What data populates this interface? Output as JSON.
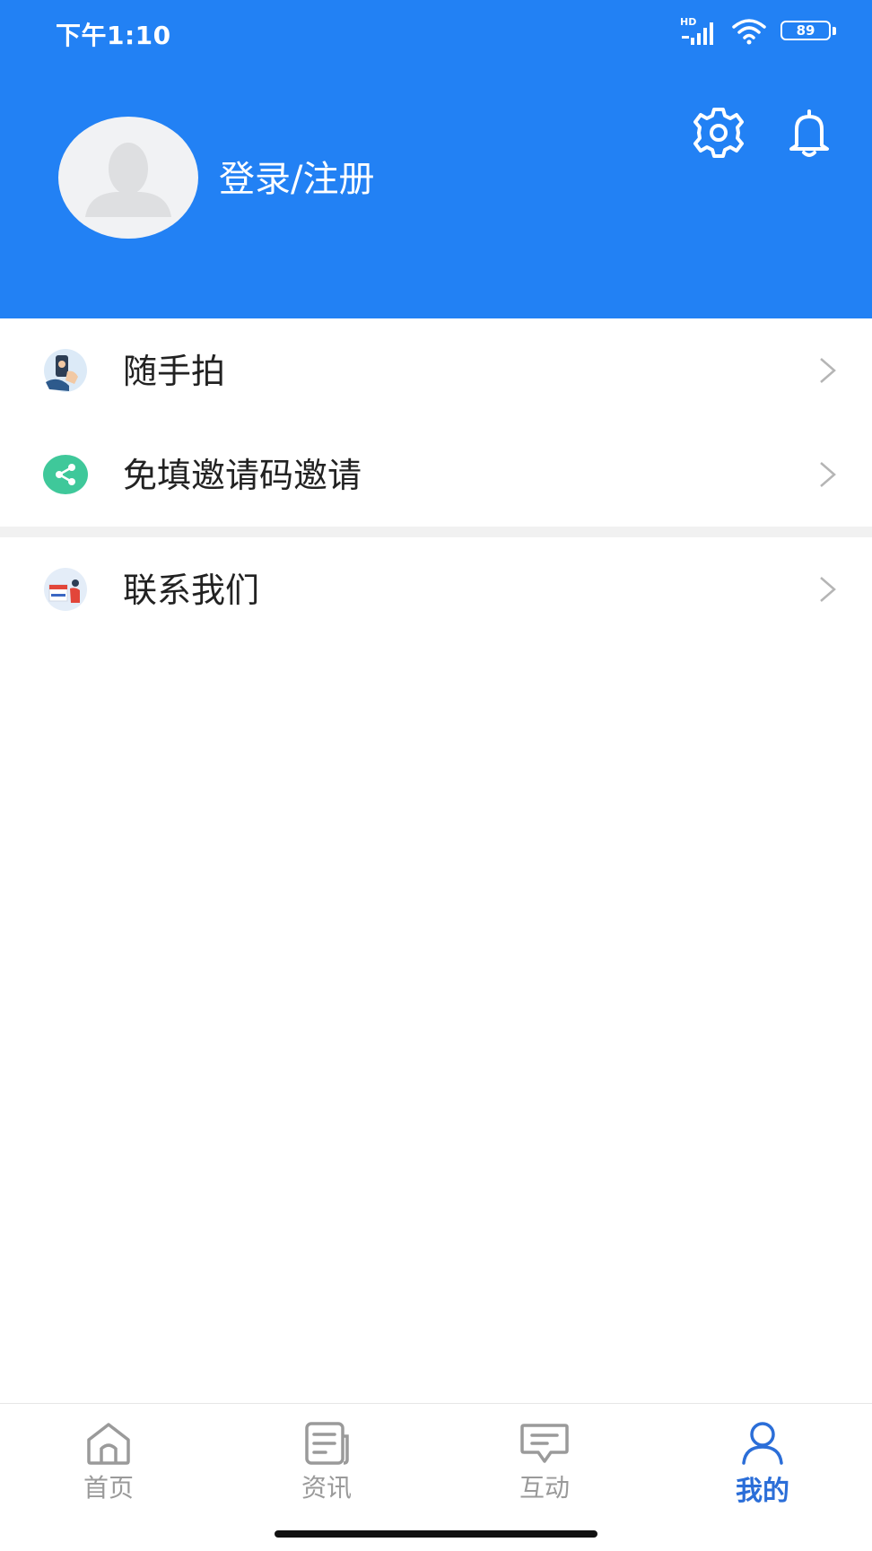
{
  "status_bar": {
    "time": "下午1:10",
    "network": "HD",
    "battery": "89"
  },
  "profile": {
    "login_label": "登录/注册"
  },
  "header_icons": [
    "settings-gear-icon",
    "notification-bell-icon"
  ],
  "menu": {
    "items": [
      {
        "label": "随手拍",
        "icon": "photo-shoot-icon"
      },
      {
        "label": "免填邀请码邀请",
        "icon": "share-icon"
      },
      {
        "label": "联系我们",
        "icon": "contact-us-icon"
      }
    ]
  },
  "tabbar": {
    "tabs": [
      {
        "label": "首页",
        "icon": "home-icon"
      },
      {
        "label": "资讯",
        "icon": "news-icon"
      },
      {
        "label": "互动",
        "icon": "chat-icon"
      },
      {
        "label": "我的",
        "icon": "user-icon"
      }
    ],
    "active_index": 3
  },
  "colors": {
    "brand_blue": "#2281f4",
    "active_tab": "#2b6ed8",
    "inactive_tab": "#9a9a9a"
  }
}
